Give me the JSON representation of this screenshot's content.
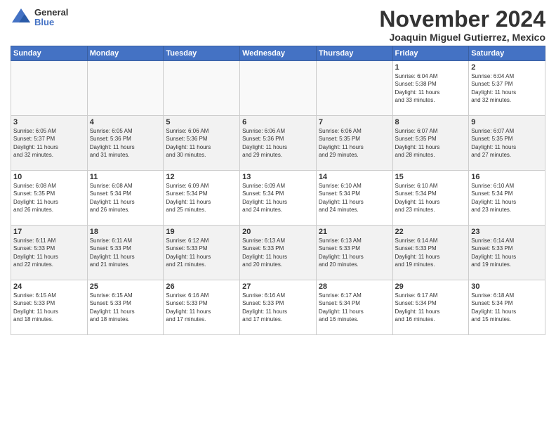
{
  "logo": {
    "general": "General",
    "blue": "Blue"
  },
  "title": "November 2024",
  "subtitle": "Joaquin Miguel Gutierrez, Mexico",
  "days_of_week": [
    "Sunday",
    "Monday",
    "Tuesday",
    "Wednesday",
    "Thursday",
    "Friday",
    "Saturday"
  ],
  "weeks": [
    [
      {
        "day": "",
        "info": ""
      },
      {
        "day": "",
        "info": ""
      },
      {
        "day": "",
        "info": ""
      },
      {
        "day": "",
        "info": ""
      },
      {
        "day": "",
        "info": ""
      },
      {
        "day": "1",
        "info": "Sunrise: 6:04 AM\nSunset: 5:38 PM\nDaylight: 11 hours\nand 33 minutes."
      },
      {
        "day": "2",
        "info": "Sunrise: 6:04 AM\nSunset: 5:37 PM\nDaylight: 11 hours\nand 32 minutes."
      }
    ],
    [
      {
        "day": "3",
        "info": "Sunrise: 6:05 AM\nSunset: 5:37 PM\nDaylight: 11 hours\nand 32 minutes."
      },
      {
        "day": "4",
        "info": "Sunrise: 6:05 AM\nSunset: 5:36 PM\nDaylight: 11 hours\nand 31 minutes."
      },
      {
        "day": "5",
        "info": "Sunrise: 6:06 AM\nSunset: 5:36 PM\nDaylight: 11 hours\nand 30 minutes."
      },
      {
        "day": "6",
        "info": "Sunrise: 6:06 AM\nSunset: 5:36 PM\nDaylight: 11 hours\nand 29 minutes."
      },
      {
        "day": "7",
        "info": "Sunrise: 6:06 AM\nSunset: 5:35 PM\nDaylight: 11 hours\nand 29 minutes."
      },
      {
        "day": "8",
        "info": "Sunrise: 6:07 AM\nSunset: 5:35 PM\nDaylight: 11 hours\nand 28 minutes."
      },
      {
        "day": "9",
        "info": "Sunrise: 6:07 AM\nSunset: 5:35 PM\nDaylight: 11 hours\nand 27 minutes."
      }
    ],
    [
      {
        "day": "10",
        "info": "Sunrise: 6:08 AM\nSunset: 5:35 PM\nDaylight: 11 hours\nand 26 minutes."
      },
      {
        "day": "11",
        "info": "Sunrise: 6:08 AM\nSunset: 5:34 PM\nDaylight: 11 hours\nand 26 minutes."
      },
      {
        "day": "12",
        "info": "Sunrise: 6:09 AM\nSunset: 5:34 PM\nDaylight: 11 hours\nand 25 minutes."
      },
      {
        "day": "13",
        "info": "Sunrise: 6:09 AM\nSunset: 5:34 PM\nDaylight: 11 hours\nand 24 minutes."
      },
      {
        "day": "14",
        "info": "Sunrise: 6:10 AM\nSunset: 5:34 PM\nDaylight: 11 hours\nand 24 minutes."
      },
      {
        "day": "15",
        "info": "Sunrise: 6:10 AM\nSunset: 5:34 PM\nDaylight: 11 hours\nand 23 minutes."
      },
      {
        "day": "16",
        "info": "Sunrise: 6:10 AM\nSunset: 5:34 PM\nDaylight: 11 hours\nand 23 minutes."
      }
    ],
    [
      {
        "day": "17",
        "info": "Sunrise: 6:11 AM\nSunset: 5:33 PM\nDaylight: 11 hours\nand 22 minutes."
      },
      {
        "day": "18",
        "info": "Sunrise: 6:11 AM\nSunset: 5:33 PM\nDaylight: 11 hours\nand 21 minutes."
      },
      {
        "day": "19",
        "info": "Sunrise: 6:12 AM\nSunset: 5:33 PM\nDaylight: 11 hours\nand 21 minutes."
      },
      {
        "day": "20",
        "info": "Sunrise: 6:13 AM\nSunset: 5:33 PM\nDaylight: 11 hours\nand 20 minutes."
      },
      {
        "day": "21",
        "info": "Sunrise: 6:13 AM\nSunset: 5:33 PM\nDaylight: 11 hours\nand 20 minutes."
      },
      {
        "day": "22",
        "info": "Sunrise: 6:14 AM\nSunset: 5:33 PM\nDaylight: 11 hours\nand 19 minutes."
      },
      {
        "day": "23",
        "info": "Sunrise: 6:14 AM\nSunset: 5:33 PM\nDaylight: 11 hours\nand 19 minutes."
      }
    ],
    [
      {
        "day": "24",
        "info": "Sunrise: 6:15 AM\nSunset: 5:33 PM\nDaylight: 11 hours\nand 18 minutes."
      },
      {
        "day": "25",
        "info": "Sunrise: 6:15 AM\nSunset: 5:33 PM\nDaylight: 11 hours\nand 18 minutes."
      },
      {
        "day": "26",
        "info": "Sunrise: 6:16 AM\nSunset: 5:33 PM\nDaylight: 11 hours\nand 17 minutes."
      },
      {
        "day": "27",
        "info": "Sunrise: 6:16 AM\nSunset: 5:33 PM\nDaylight: 11 hours\nand 17 minutes."
      },
      {
        "day": "28",
        "info": "Sunrise: 6:17 AM\nSunset: 5:34 PM\nDaylight: 11 hours\nand 16 minutes."
      },
      {
        "day": "29",
        "info": "Sunrise: 6:17 AM\nSunset: 5:34 PM\nDaylight: 11 hours\nand 16 minutes."
      },
      {
        "day": "30",
        "info": "Sunrise: 6:18 AM\nSunset: 5:34 PM\nDaylight: 11 hours\nand 15 minutes."
      }
    ]
  ]
}
